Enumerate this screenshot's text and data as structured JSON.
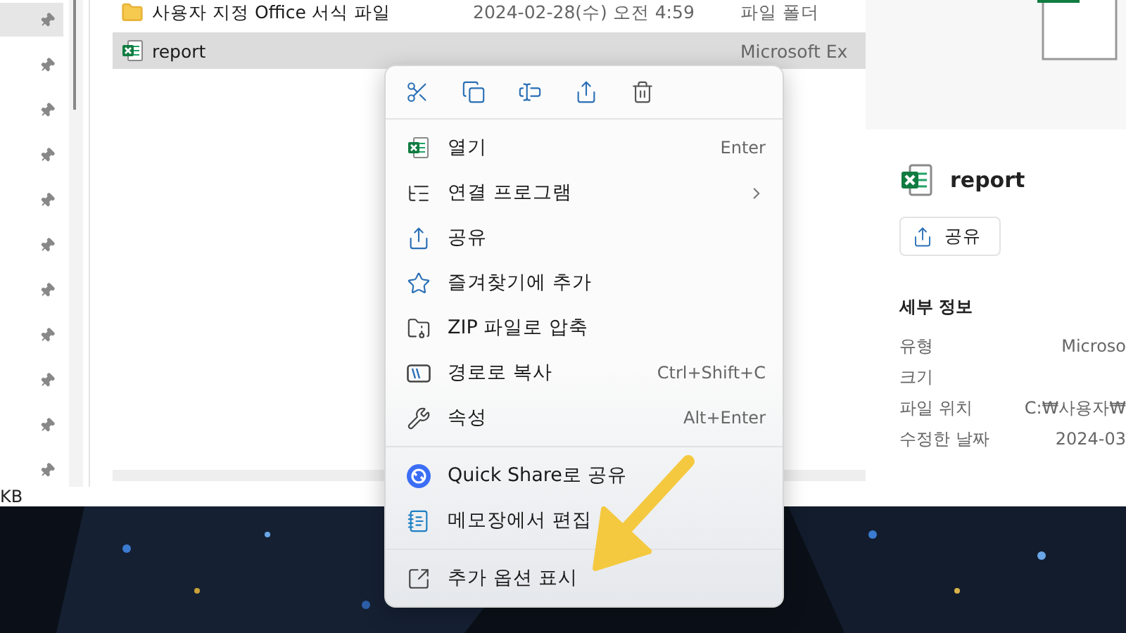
{
  "navigation_pane": {
    "rows": [
      {
        "selected": true
      },
      {
        "selected": false
      },
      {
        "selected": false
      },
      {
        "selected": false
      },
      {
        "selected": false
      },
      {
        "selected": false
      },
      {
        "selected": false
      },
      {
        "selected": false
      },
      {
        "selected": false
      },
      {
        "selected": false
      },
      {
        "selected": false
      }
    ]
  },
  "file_list": {
    "rows": [
      {
        "kind": "folder",
        "name": "사용자 지정 Office 서식 파일",
        "date": "2024-02-28(수) 오전 4:59",
        "type": "파일 폴더",
        "selected": false
      },
      {
        "kind": "excel",
        "name": "report",
        "type": "Microsoft Ex",
        "selected": true
      }
    ]
  },
  "status_bar": {
    "text": "KB"
  },
  "details_pane": {
    "file_name": "report",
    "share_button": "공유",
    "section_title": "세부 정보",
    "properties": [
      {
        "label": "유형",
        "value": "Microso"
      },
      {
        "label": "크기"
      },
      {
        "label": "파일 위치",
        "value": "C:₩사용자₩"
      },
      {
        "label": "수정한 날짜",
        "value": "2024-03"
      }
    ]
  },
  "context_menu": {
    "toolbar": [
      {
        "kind": "cut"
      },
      {
        "kind": "copy"
      },
      {
        "kind": "rename"
      },
      {
        "kind": "share"
      },
      {
        "kind": "delete"
      }
    ],
    "sections": [
      [
        {
          "kind": "excel",
          "label": "열기",
          "shortcut": "Enter"
        },
        {
          "kind": "open-with",
          "label": "연결 프로그램",
          "submenu": true
        },
        {
          "kind": "share",
          "label": "공유"
        },
        {
          "kind": "star",
          "label": "즐겨찾기에 추가"
        },
        {
          "kind": "zip",
          "label": "ZIP 파일로 압축"
        },
        {
          "kind": "path",
          "label": "경로로 복사",
          "shortcut": "Ctrl+Shift+C"
        },
        {
          "kind": "wrench",
          "label": "속성",
          "shortcut": "Alt+Enter"
        }
      ],
      [
        {
          "kind": "quick-share",
          "label": "Quick Share로 공유"
        },
        {
          "kind": "notepad",
          "label": "메모장에서 편집"
        }
      ],
      [
        {
          "kind": "more",
          "label": "추가 옵션 표시"
        }
      ]
    ]
  }
}
